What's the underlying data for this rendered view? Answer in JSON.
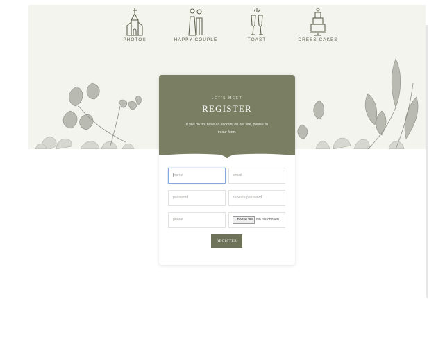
{
  "nav": {
    "items": [
      {
        "label": "PHOTOS",
        "icon": "church-icon"
      },
      {
        "label": "HAPPY COUPLE",
        "icon": "couple-icon"
      },
      {
        "label": "TOAST",
        "icon": "champagne-glasses-icon"
      },
      {
        "label": "DRESS CAKES",
        "icon": "cake-icon"
      }
    ]
  },
  "form": {
    "eyebrow": "LET'S MEET",
    "title": "REGISTER",
    "description": "If you do not have an account on our site, please fill in our form.",
    "fields": {
      "name_placeholder": "name",
      "email_placeholder": "email",
      "password_placeholder": "password",
      "repeat_password_placeholder": "repeate password",
      "phone_placeholder": "phone"
    },
    "file": {
      "button_label": "Choose file",
      "status": "No file chosen"
    },
    "submit_label": "REGISTER"
  },
  "colors": {
    "accent": "#7a7e63",
    "button": "#6d7258",
    "hero_background": "#f4f4ef"
  }
}
